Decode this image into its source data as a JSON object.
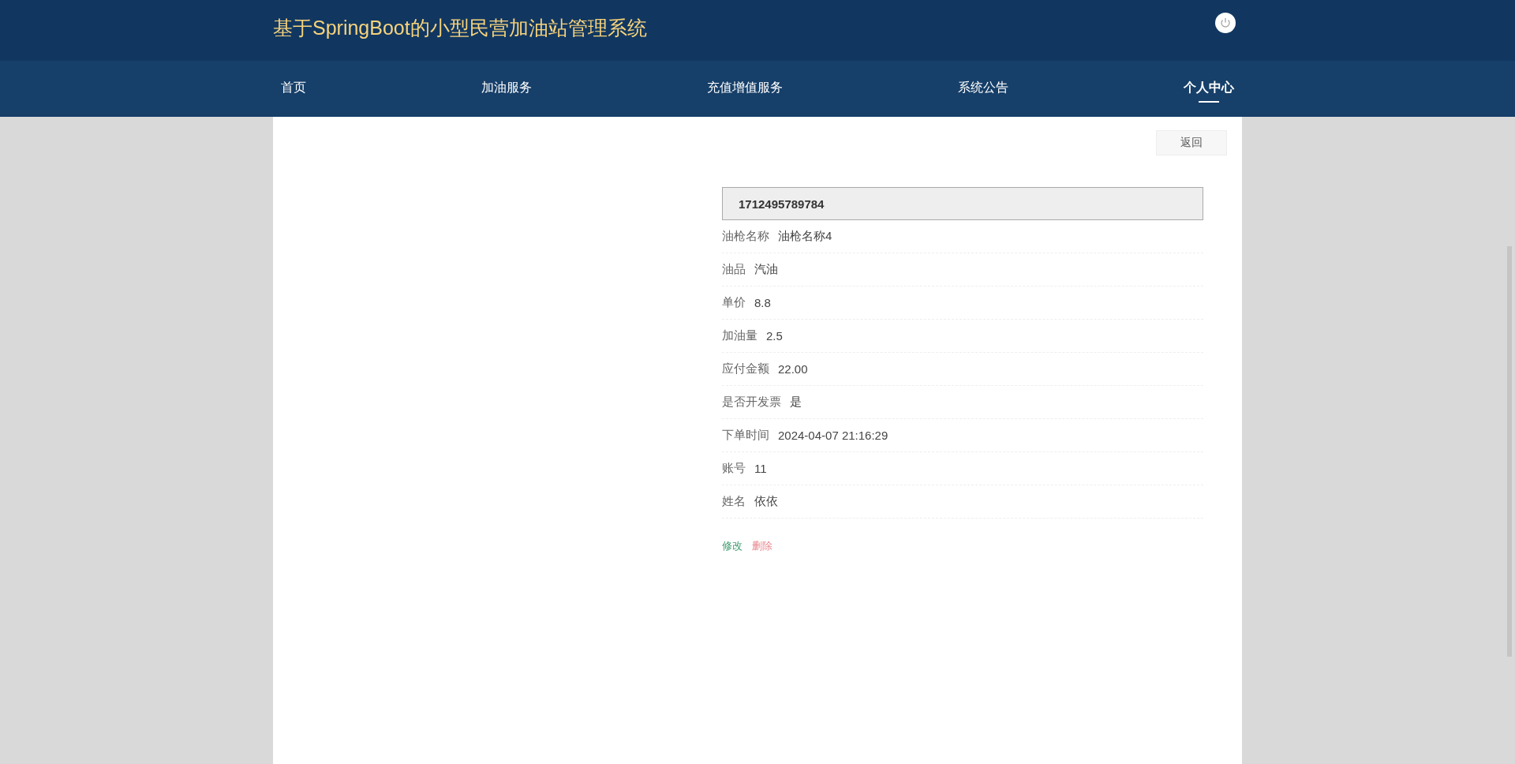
{
  "header": {
    "title": "基于SpringBoot的小型民营加油站管理系统"
  },
  "nav": [
    {
      "label": "首页",
      "selected": false
    },
    {
      "label": "加油服务",
      "selected": false
    },
    {
      "label": "充值增值服务",
      "selected": false
    },
    {
      "label": "系统公告",
      "selected": false
    },
    {
      "label": "个人中心",
      "selected": true
    }
  ],
  "back_button": "返回",
  "detail": {
    "title": "1712495789784",
    "fields": [
      {
        "label": "油枪名称",
        "value": "油枪名称4"
      },
      {
        "label": "油品",
        "value": "汽油"
      },
      {
        "label": "单价",
        "value": "8.8"
      },
      {
        "label": "加油量",
        "value": "2.5"
      },
      {
        "label": "应付金额",
        "value": "22.00"
      },
      {
        "label": "是否开发票",
        "value": "是"
      },
      {
        "label": "下单时间",
        "value": "2024-04-07 21:16:29"
      },
      {
        "label": "账号",
        "value": "11"
      },
      {
        "label": "姓名",
        "value": "依依"
      }
    ]
  },
  "actions": [
    {
      "label": "修改",
      "kind": "edit"
    },
    {
      "label": "删除",
      "kind": "delete"
    }
  ]
}
